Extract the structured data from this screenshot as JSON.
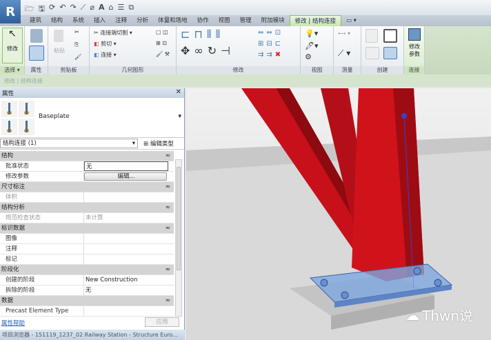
{
  "app": {
    "logo": "R"
  },
  "tabs": [
    "建筑",
    "结构",
    "系统",
    "插入",
    "注释",
    "分析",
    "体量和场地",
    "协作",
    "视图",
    "管理",
    "附加模块",
    "修改 | 结构连接"
  ],
  "active_tab": "修改 | 结构连接",
  "ribbon": {
    "select": {
      "button": "修改",
      "label": "选择 ▾"
    },
    "properties": {
      "label": "属性"
    },
    "clipboard": {
      "paste": "粘贴",
      "label": "剪贴板"
    },
    "geometry": {
      "cope": "连接端切割 ▾",
      "cut": "剪切 ▾",
      "join": "连接 ▾",
      "label": "几何图形"
    },
    "modify": {
      "label": "修改"
    },
    "view": {
      "label": "视图"
    },
    "measure": {
      "label": "测量"
    },
    "create": {
      "label": "创建"
    },
    "connection": {
      "button_line1": "修改",
      "button_line2": "参数",
      "label": "连接"
    }
  },
  "context_bar": "修改 | 结构连接",
  "properties": {
    "title": "属性",
    "type_name": "Baseplate",
    "filter": "结构连接 (1)",
    "edit_type": "编辑类型",
    "rows": [
      {
        "group": "结构"
      },
      {
        "k": "批准状态",
        "v": "无",
        "style": "box"
      },
      {
        "k": "修改参数",
        "v": "编辑...",
        "style": "btn"
      },
      {
        "group": "尺寸标注"
      },
      {
        "k": "体积",
        "v": "",
        "style": "dim"
      },
      {
        "group": "结构分析"
      },
      {
        "k": "规范检查状态",
        "v": "未计算",
        "style": "dim"
      },
      {
        "group": "标识数据"
      },
      {
        "k": "图像",
        "v": ""
      },
      {
        "k": "注释",
        "v": ""
      },
      {
        "k": "标记",
        "v": ""
      },
      {
        "group": "阶段化"
      },
      {
        "k": "创建的阶段",
        "v": "New Construction"
      },
      {
        "k": "拆除的阶段",
        "v": "无"
      },
      {
        "group": "数据"
      },
      {
        "k": "Precast Element Type",
        "v": ""
      }
    ],
    "help_link": "属性帮助",
    "apply": "应用"
  },
  "project_browser": "项目浏览器 - 151119_1237_02 Railway Station - Structure Euro...",
  "watermark": "Thwn说",
  "colors": {
    "steel": "#d0121b",
    "plate": "#7ea7e0",
    "ribbon_active": "#c7e6b0"
  }
}
